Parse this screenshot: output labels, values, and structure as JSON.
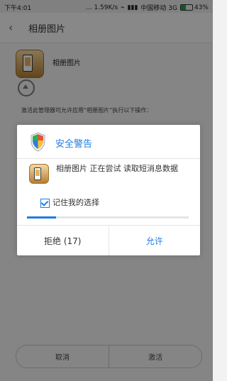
{
  "status_bar": {
    "time": "下午4:01",
    "speed": "... 1.59K/s",
    "wifi_icon": "wifi-icon",
    "signal_icon": "signal-icon",
    "carrier": "中国移动 3G",
    "battery_percent": "43%",
    "battery_level": 0.43,
    "battery_color": "#1aa34a"
  },
  "header": {
    "back_icon": "back-icon",
    "title": "相册图片"
  },
  "app_info": {
    "name": "相册图片",
    "description": "激活此管理器可允许应用“相册图片”执行以下操作："
  },
  "bottom_actions": {
    "cancel": "取消",
    "activate": "激活"
  },
  "dialog": {
    "title": "安全警告",
    "message": "相册图片 正在尝试 读取短消息数据",
    "checkbox_label": "记住我的选择",
    "progress_fraction": 0.18,
    "reject_label": "拒绝 (17)",
    "allow_label": "允许",
    "accent": "#1f7de3",
    "shield_icon": "shield-icon"
  }
}
